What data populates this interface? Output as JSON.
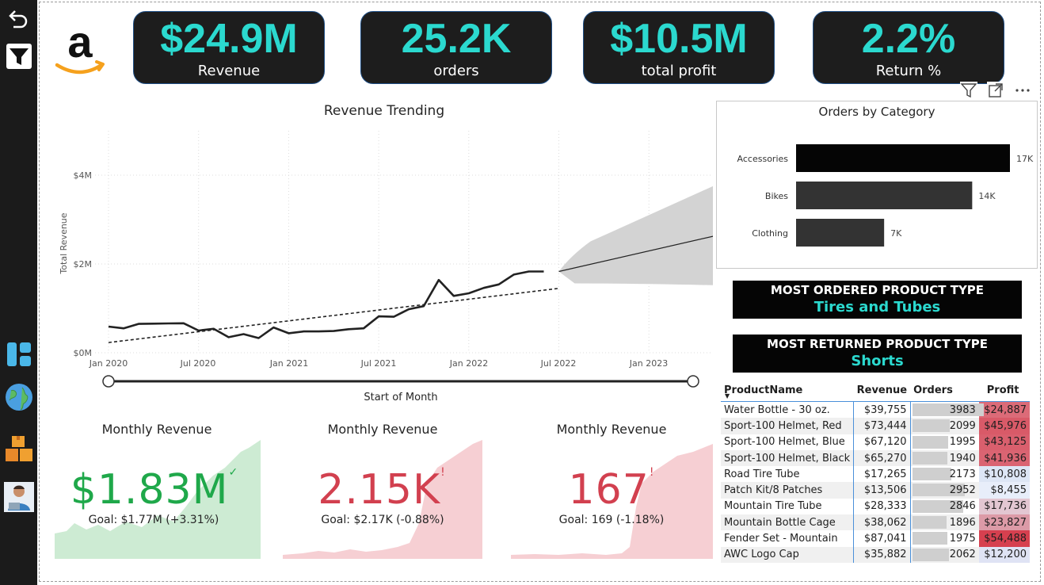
{
  "kpis": [
    {
      "value": "$24.9M",
      "label": "Revenue"
    },
    {
      "value": "25.2K",
      "label": "orders"
    },
    {
      "value": "$10.5M",
      "label": "total profit"
    },
    {
      "value": "2.2%",
      "label": "Return %"
    }
  ],
  "trend": {
    "title": "Revenue Trending",
    "xlabel": "Start of Month",
    "ylabel": "Total Revenue",
    "yticks": [
      "$4M",
      "$2M",
      "$0M"
    ],
    "xticks": [
      "Jan 2020",
      "Jul 2020",
      "Jan 2021",
      "Jul 2021",
      "Jan 2022",
      "Jul 2022",
      "Jan 2023"
    ]
  },
  "chart_data": [
    {
      "type": "line",
      "title": "Revenue Trending",
      "xlabel": "Start of Month",
      "ylabel": "Total Revenue",
      "ylim": [
        0,
        4000000
      ],
      "x": [
        "2020-01",
        "2020-02",
        "2020-03",
        "2020-04",
        "2020-05",
        "2020-06",
        "2020-07",
        "2020-08",
        "2020-09",
        "2020-10",
        "2020-11",
        "2020-12",
        "2021-01",
        "2021-02",
        "2021-03",
        "2021-04",
        "2021-05",
        "2021-06",
        "2021-07",
        "2021-08",
        "2021-09",
        "2021-10",
        "2021-11",
        "2021-12",
        "2022-01",
        "2022-02",
        "2022-03",
        "2022-04",
        "2022-05",
        "2022-06"
      ],
      "series": [
        {
          "values": [
            590000,
            550000,
            650000,
            655000,
            660000,
            665000,
            500000,
            540000,
            350000,
            420000,
            330000,
            570000,
            440000,
            480000,
            480000,
            490000,
            530000,
            550000,
            820000,
            810000,
            980000,
            1050000,
            1640000,
            1280000,
            1340000,
            1460000,
            1540000,
            1760000,
            1830000,
            1830000
          ]
        }
      ],
      "trendline": {
        "start": [
          2020.0,
          230000
        ],
        "end": [
          2022.5,
          1450000
        ]
      },
      "forecast": {
        "start": [
          2022.5,
          1830000
        ],
        "end": [
          2023.6,
          2850000
        ],
        "upper_end": 4200000,
        "lower_end": 1500000
      }
    },
    {
      "type": "bar",
      "title": "Orders by Category",
      "categories": [
        "Accessories",
        "Bikes",
        "Clothing"
      ],
      "values": [
        17000,
        14000,
        7000
      ],
      "data_labels": [
        "17K",
        "14K",
        "7K"
      ]
    }
  ],
  "category": {
    "title": "Orders by Category"
  },
  "banners": [
    {
      "label": "MOST ORDERED PRODUCT TYPE",
      "value": "Tires and Tubes"
    },
    {
      "label": "MOST RETURNED PRODUCT TYPE",
      "value": "Shorts"
    }
  ],
  "table": {
    "headers": [
      "ProductName",
      "Revenue",
      "Orders",
      "Profit"
    ],
    "rows": [
      {
        "name": "Water Bottle - 30 oz.",
        "revenue": "$39,755",
        "orders": "3983",
        "orders_n": 3983,
        "profit": "$24,887",
        "profit_color": "#dc6b78"
      },
      {
        "name": "Sport-100 Helmet, Red",
        "revenue": "$73,444",
        "orders": "2099",
        "orders_n": 2099,
        "profit": "$45,976",
        "profit_color": "#d95a68"
      },
      {
        "name": "Sport-100 Helmet, Blue",
        "revenue": "$67,120",
        "orders": "1995",
        "orders_n": 1995,
        "profit": "$43,125",
        "profit_color": "#d95f6d"
      },
      {
        "name": "Sport-100 Helmet, Black",
        "revenue": "$65,270",
        "orders": "1940",
        "orders_n": 1940,
        "profit": "$41,936",
        "profit_color": "#da6472"
      },
      {
        "name": "Road Tire Tube",
        "revenue": "$17,265",
        "orders": "2173",
        "orders_n": 2173,
        "profit": "$10,808",
        "profit_color": "#dde6f5"
      },
      {
        "name": "Patch Kit/8 Patches",
        "revenue": "$13,506",
        "orders": "2952",
        "orders_n": 2952,
        "profit": "$8,455",
        "profit_color": "#e8eefa"
      },
      {
        "name": "Mountain Tire Tube",
        "revenue": "$28,333",
        "orders": "2846",
        "orders_n": 2846,
        "profit": "$17,736",
        "profit_color": "#e3c7d2"
      },
      {
        "name": "Mountain Bottle Cage",
        "revenue": "$38,062",
        "orders": "1896",
        "orders_n": 1896,
        "profit": "$23,827",
        "profit_color": "#dc9aa7"
      },
      {
        "name": "Fender Set - Mountain",
        "revenue": "$87,041",
        "orders": "1975",
        "orders_n": 1975,
        "profit": "$54,488",
        "profit_color": "#d6404f"
      },
      {
        "name": "AWC Logo Cap",
        "revenue": "$35,882",
        "orders": "2062",
        "orders_n": 2062,
        "profit": "$12,200",
        "profit_color": "#dfe3f4"
      }
    ]
  },
  "monthly": [
    {
      "title": "Monthly Revenue",
      "value": "$1.83M",
      "indicator": "✓",
      "goal": "Goal: $1.77M (+3.31%)",
      "color": "#1fa84a",
      "fill": "#cdebd3"
    },
    {
      "title": "Monthly Revenue",
      "value": "2.15K",
      "indicator": "!",
      "goal": "Goal: $2.17K (-0.88%)",
      "color": "#d2404f",
      "fill": "#f6cfd3"
    },
    {
      "title": "Monthly Revenue",
      "value": "167",
      "indicator": "!",
      "goal": "Goal: 169 (-1.18%)",
      "color": "#d2404f",
      "fill": "#f6cfd3"
    }
  ],
  "icons": {
    "back": "back-arrow-icon",
    "filter": "filter-icon",
    "dashboard": "dashboard-icon",
    "globe": "globe-icon",
    "boxes": "boxes-icon",
    "user": "user-icon"
  }
}
